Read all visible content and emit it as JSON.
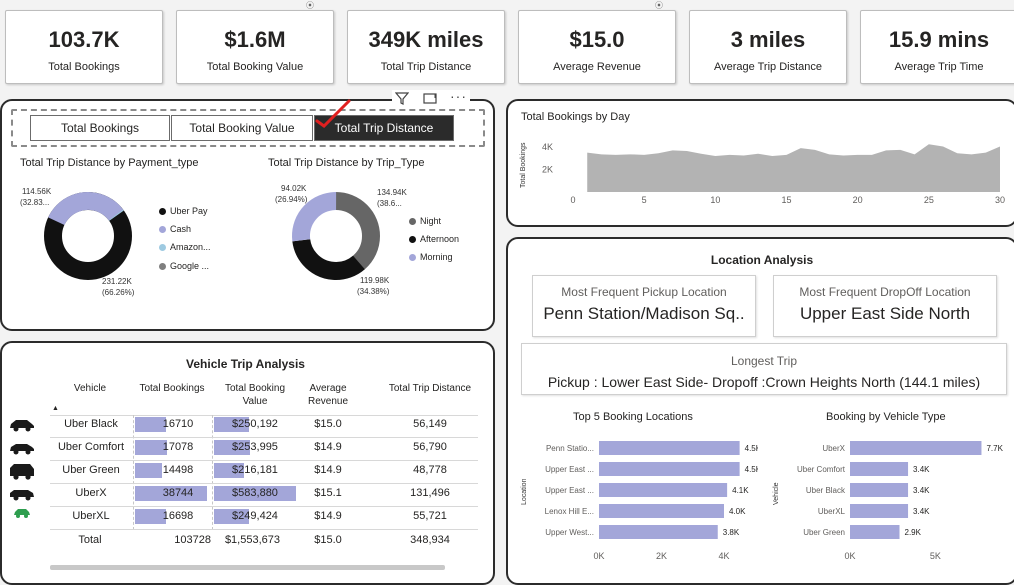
{
  "kpis": [
    {
      "value": "103.7K",
      "label": "Total Bookings"
    },
    {
      "value": "$1.6M",
      "label": "Total Booking Value"
    },
    {
      "value": "349K miles",
      "label": "Total Trip Distance"
    },
    {
      "value": "$15.0",
      "label": "Average Revenue"
    },
    {
      "value": "3 miles",
      "label": "Average Trip Distance"
    },
    {
      "value": "15.9 mins",
      "label": "Average Trip Time"
    }
  ],
  "slicer": {
    "buttons": [
      "Total Bookings",
      "Total Booking Value",
      "Total Trip Distance"
    ],
    "selected": "Total Trip Distance"
  },
  "donut_payment": {
    "title": "Total Trip Distance by Payment_type",
    "label_top": "114.56K",
    "label_top_pct": "(32.83...",
    "label_bottom": "231.22K",
    "label_bottom_pct": "(66.26%)",
    "legend": [
      {
        "name": "Uber Pay",
        "color": "#111111"
      },
      {
        "name": "Cash",
        "color": "#a3a6d9"
      },
      {
        "name": "Amazon...",
        "color": "#9ecae1"
      },
      {
        "name": "Google ...",
        "color": "#7f7f7f"
      }
    ]
  },
  "donut_trip": {
    "title": "Total Trip Distance by Trip_Type",
    "label_left": "94.02K",
    "label_left_pct": "(26.94%)",
    "label_right": "134.94K",
    "label_right_pct": "(38.6...",
    "label_bottom": "119.98K",
    "label_bottom_pct": "(34.38%)",
    "legend": [
      {
        "name": "Night",
        "color": "#666666"
      },
      {
        "name": "Afternoon",
        "color": "#111111"
      },
      {
        "name": "Morning",
        "color": "#a3a6d9"
      }
    ]
  },
  "vehicle_table": {
    "title": "Vehicle Trip Analysis",
    "headers": [
      "Vehicle",
      "Total Bookings",
      "Total Booking Value",
      "Average Revenue",
      "Total Trip Distance"
    ],
    "rows": [
      {
        "vehicle": "Uber Black",
        "bookings": "16710",
        "value": "$250,192",
        "avg": "$15.0",
        "distance": "56,149",
        "bookings_num": 16710,
        "value_num": 250192
      },
      {
        "vehicle": "Uber Comfort",
        "bookings": "17078",
        "value": "$253,995",
        "avg": "$14.9",
        "distance": "56,790",
        "bookings_num": 17078,
        "value_num": 253995
      },
      {
        "vehicle": "Uber Green",
        "bookings": "14498",
        "value": "$216,181",
        "avg": "$14.9",
        "distance": "48,778",
        "bookings_num": 14498,
        "value_num": 216181
      },
      {
        "vehicle": "UberX",
        "bookings": "38744",
        "value": "$583,880",
        "avg": "$15.1",
        "distance": "131,496",
        "bookings_num": 38744,
        "value_num": 583880
      },
      {
        "vehicle": "UberXL",
        "bookings": "16698",
        "value": "$249,424",
        "avg": "$14.9",
        "distance": "55,721",
        "bookings_num": 16698,
        "value_num": 249424
      }
    ],
    "total": {
      "vehicle": "Total",
      "bookings": "103728",
      "value": "$1,553,673",
      "avg": "$15.0",
      "distance": "348,934"
    }
  },
  "location": {
    "title": "Location Analysis",
    "pickup_title": "Most Frequent Pickup Location",
    "pickup_value": "Penn Station/Madison Sq..",
    "dropoff_title": "Most Frequent DropOff Location",
    "dropoff_value": "Upper East Side North",
    "longest_title": "Longest Trip",
    "longest_value": "Pickup : Lower East Side- Dropoff :Crown Heights North (144.1 miles)"
  },
  "colors": {
    "bar": "#a3a6d9",
    "dark": "#111111",
    "area": "#b3b3b3"
  },
  "chart_data": [
    {
      "type": "area",
      "title": "Total Bookings by Day",
      "ylabel": "Total Bookings",
      "x_ticks": [
        "0",
        "5",
        "10",
        "15",
        "20",
        "25",
        "30"
      ],
      "y_ticks": [
        "2K",
        "4K"
      ],
      "ylim": [
        0,
        4800
      ],
      "xlim": [
        0,
        30
      ],
      "x": [
        1,
        2,
        3,
        4,
        5,
        6,
        7,
        8,
        9,
        10,
        11,
        12,
        13,
        14,
        15,
        16,
        17,
        18,
        19,
        20,
        21,
        22,
        23,
        24,
        25,
        26,
        27,
        28,
        29,
        30
      ],
      "values": [
        3500,
        3350,
        3300,
        3350,
        3300,
        3450,
        3700,
        3650,
        3400,
        3200,
        3300,
        3250,
        3400,
        3200,
        3300,
        3900,
        3750,
        3350,
        3250,
        3300,
        3300,
        3700,
        3750,
        3350,
        4250,
        4050,
        3450,
        3350,
        3500,
        4050
      ]
    },
    {
      "type": "bar",
      "orientation": "horizontal",
      "title": "Top 5 Booking Locations",
      "ylabel": "Location",
      "categories": [
        "Penn Statio...",
        "Upper East ...",
        "Upper East ...",
        "Lenox Hill E...",
        "Upper West..."
      ],
      "values": [
        4500,
        4500,
        4100,
        4000,
        3800
      ],
      "value_labels": [
        "4.5K",
        "4.5K",
        "4.1K",
        "4.0K",
        "3.8K"
      ],
      "x_ticks": [
        "0K",
        "2K",
        "4K"
      ],
      "xlim": [
        0,
        4800
      ]
    },
    {
      "type": "bar",
      "orientation": "horizontal",
      "title": "Booking by Vehicle Type",
      "ylabel": "Vehicle",
      "categories": [
        "UberX",
        "Uber Comfort",
        "Uber Black",
        "UberXL",
        "Uber Green"
      ],
      "values": [
        7700,
        3400,
        3400,
        3400,
        2900
      ],
      "value_labels": [
        "7.7K",
        "3.4K",
        "3.4K",
        "3.4K",
        "2.9K"
      ],
      "x_ticks": [
        "0K",
        "5K"
      ],
      "xlim": [
        0,
        8200
      ]
    }
  ]
}
